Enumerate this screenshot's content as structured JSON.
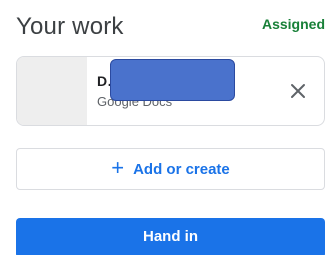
{
  "header": {
    "title": "Your work",
    "status": "Assigned"
  },
  "attachment": {
    "name": "D…",
    "type": "Google Docs",
    "remove_icon": "close-icon"
  },
  "actions": {
    "add_icon": "plus-icon",
    "add_label": "Add or create",
    "hand_in_label": "Hand in"
  },
  "colors": {
    "accent": "#1a73e8",
    "status": "#188038",
    "redaction": "#4a72cc"
  }
}
